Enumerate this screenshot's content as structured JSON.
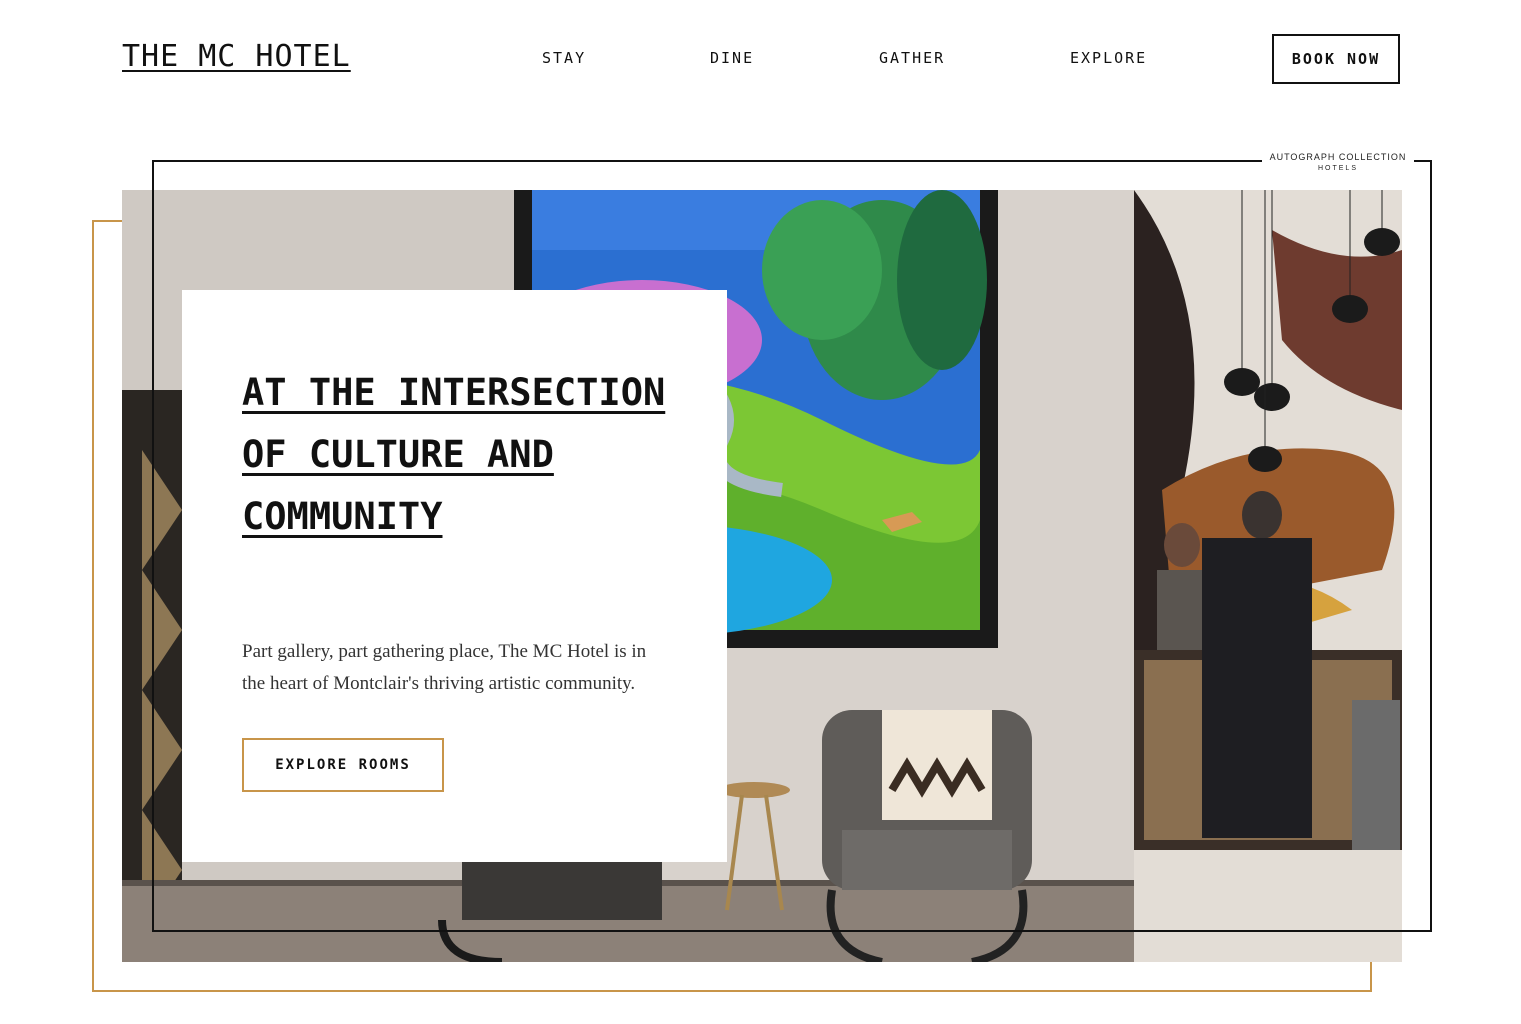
{
  "brand": {
    "logo_text": "THE MC HOTEL"
  },
  "nav": {
    "items": [
      {
        "label": "STAY"
      },
      {
        "label": "DINE"
      },
      {
        "label": "GATHER"
      },
      {
        "label": "EXPLORE"
      }
    ],
    "cta_label": "BOOK NOW"
  },
  "hero": {
    "badge": {
      "line1": "AUTOGRAPH COLLECTION",
      "line2": "HOTELS"
    },
    "headline": "AT THE INTERSECTION OF CULTURE AND COMMUNITY",
    "description": "Part gallery, part gathering place, The MC Hotel is in the heart of Montclair's thriving artistic community.",
    "cta_label": "EXPLORE ROOMS"
  },
  "colors": {
    "accent_gold": "#c8954a",
    "ink": "#111111",
    "background": "#ffffff"
  }
}
